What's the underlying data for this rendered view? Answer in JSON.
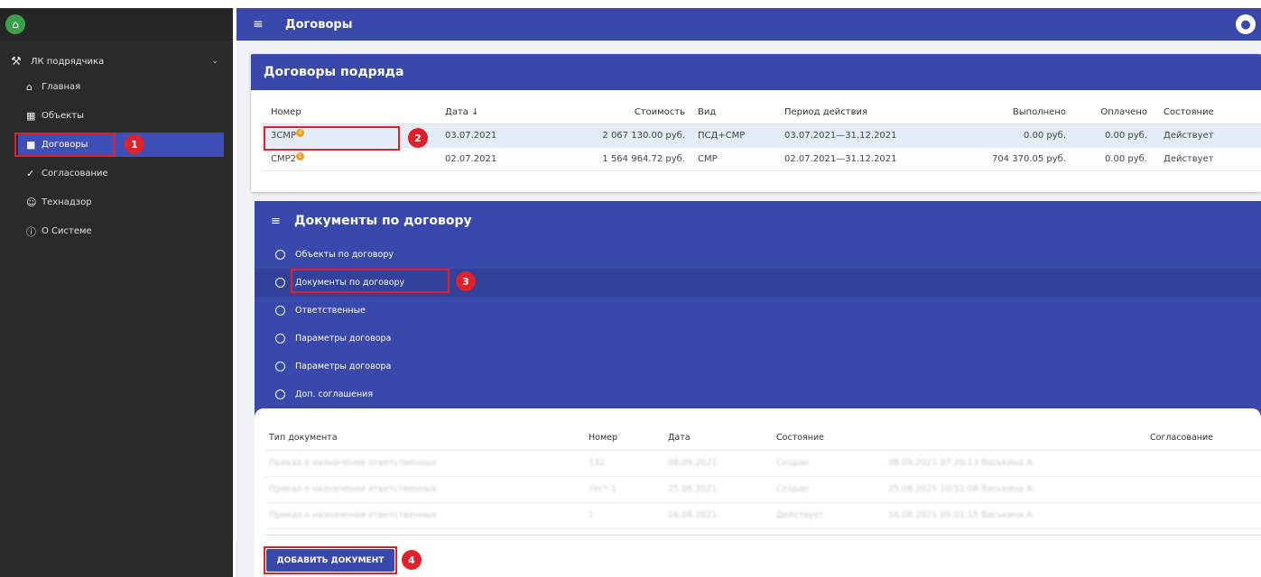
{
  "header": {
    "title": "Договоры"
  },
  "sidebar": {
    "group_label": "ЛК подрядчика",
    "items": [
      {
        "label": "Главная",
        "icon": "home-icon"
      },
      {
        "label": "Объекты",
        "icon": "buildings-icon"
      },
      {
        "label": "Договоры",
        "icon": "briefcase-icon",
        "active": true
      },
      {
        "label": "Согласование",
        "icon": "thumbs-up-icon"
      },
      {
        "label": "Технадзор",
        "icon": "people-icon"
      },
      {
        "label": "О Системе",
        "icon": "info-icon"
      }
    ]
  },
  "contracts": {
    "title": "Договоры подряда",
    "columns": [
      "Номер",
      "Дата ↓",
      "Стоимость",
      "Вид",
      "Период действия",
      "Выполнено",
      "Оплачено",
      "Состояние"
    ],
    "rows": [
      {
        "number": "3СМР",
        "badge": "4",
        "date": "03.07.2021",
        "cost": "2 067 130.00 руб.",
        "type": "ПСД+СМР",
        "period": "03.07.2021—31.12.2021",
        "done": "0.00 руб.",
        "paid": "0.00 руб.",
        "state": "Действует"
      },
      {
        "number": "СМР2",
        "badge": "1",
        "date": "02.07.2021",
        "cost": "1 564 964.72 руб.",
        "type": "СМР",
        "period": "02.07.2021—31.12.2021",
        "done": "704 370.05 руб.",
        "paid": "0.00 руб.",
        "state": "Действует"
      }
    ]
  },
  "documents_panel": {
    "title": "Документы по договору",
    "items": [
      {
        "label": "Объекты по договору"
      },
      {
        "label": "Документы по договору",
        "active": true
      },
      {
        "label": "Ответственные"
      },
      {
        "label": "Параметры договора"
      },
      {
        "label": "Параметры договора"
      },
      {
        "label": "Доп. соглашения"
      }
    ]
  },
  "documents": {
    "columns": [
      "Тип документа",
      "Номер",
      "Дата",
      "Состояние",
      "",
      "Согласование"
    ],
    "rows": [
      {
        "type": "Приказ о назначении ответственных",
        "number": "132",
        "date": "08.09.2021",
        "state": "Создан",
        "note": "08.09.2021 07:20:13 Васькина А.",
        "approval": ""
      },
      {
        "type": "Приказ о назначении ответственных",
        "number": "тест 1",
        "date": "25.08.2021",
        "state": "Создан",
        "note": "25.08.2021 10:51:08 Васькина А.",
        "approval": ""
      },
      {
        "type": "Приказ о назначении ответственных",
        "number": "1",
        "date": "16.08.2021",
        "state": "Действует",
        "note": "16.08.2021 09:01:15 Васькина А.",
        "approval": ""
      }
    ],
    "add_button": "ДОБАВИТЬ ДОКУМЕНТ"
  },
  "annotations": [
    "1",
    "2",
    "3",
    "4"
  ]
}
